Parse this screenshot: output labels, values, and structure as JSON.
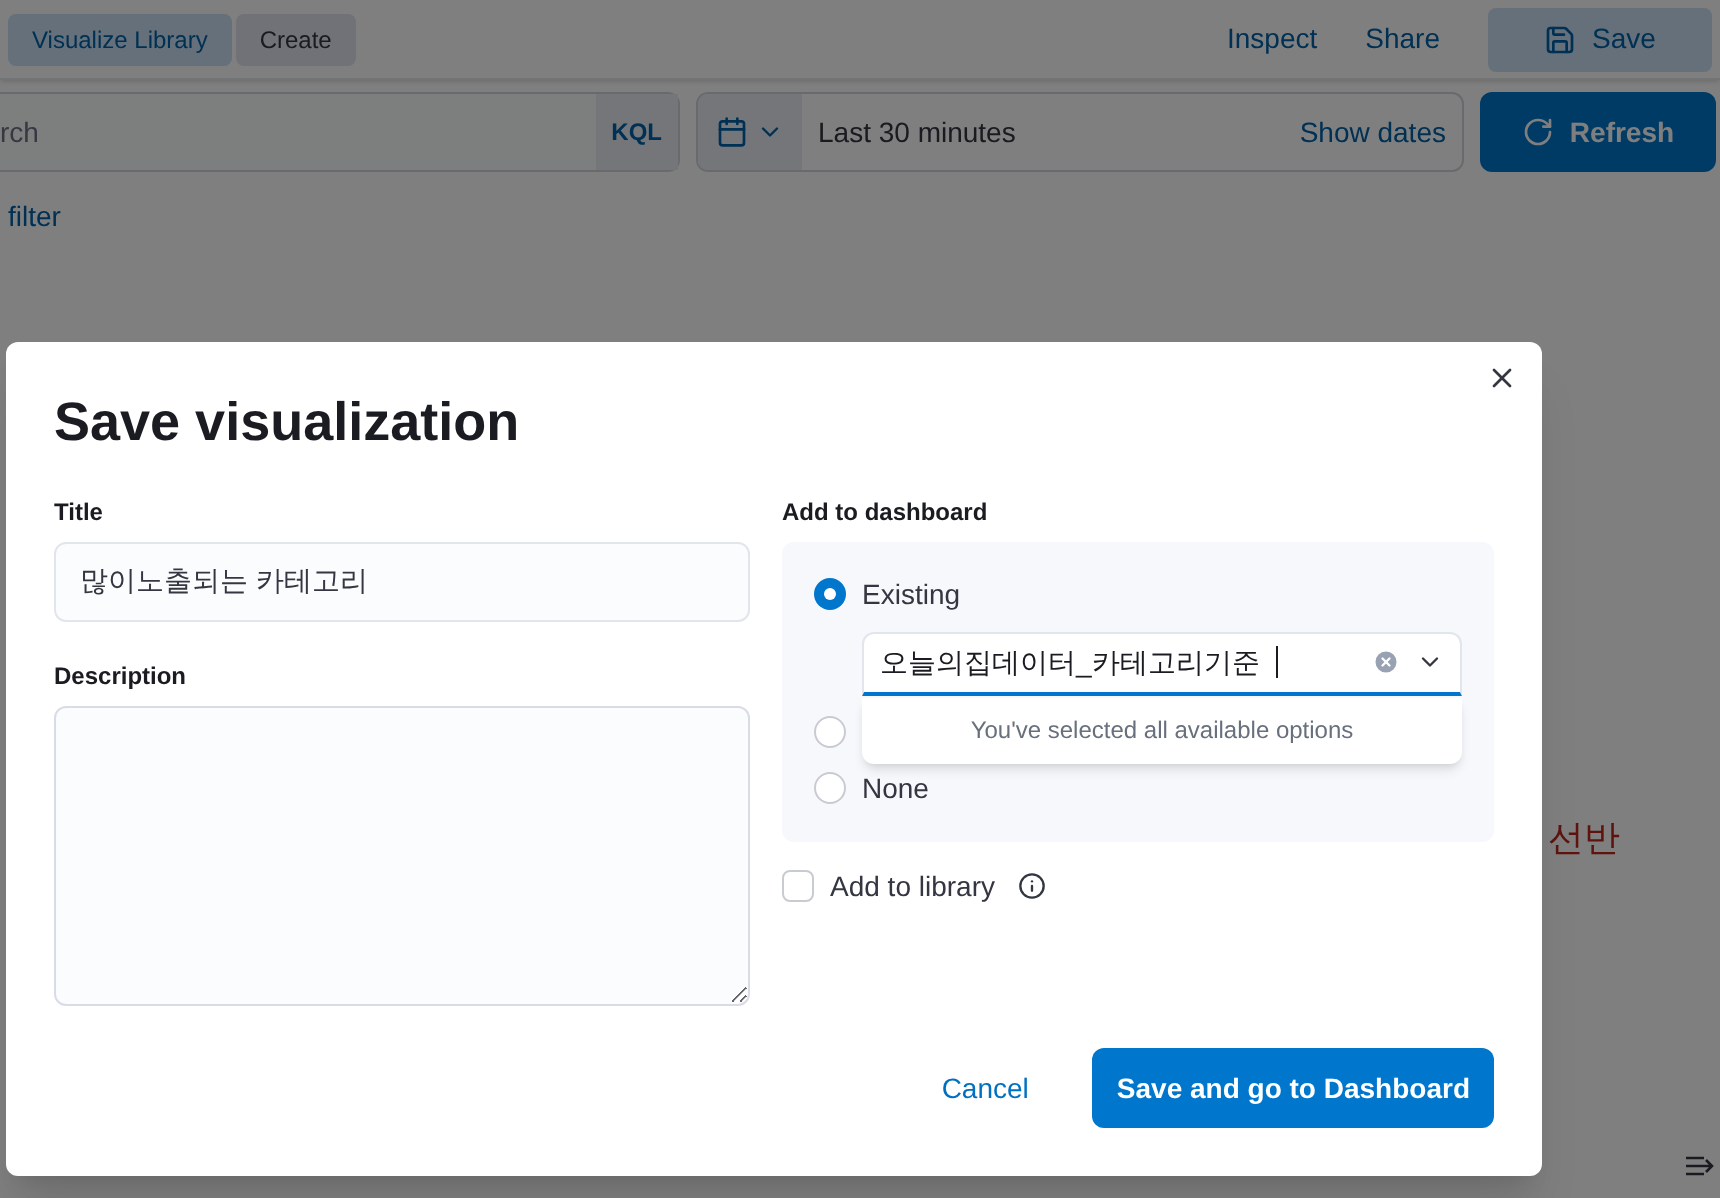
{
  "header": {
    "breadcrumbs": [
      {
        "label": "Visualize Library",
        "selected": false
      },
      {
        "label": "Create",
        "selected": true
      }
    ],
    "links": [
      "Inspect",
      "Share"
    ],
    "save_button": "Save"
  },
  "query_bar": {
    "search_value": "rch",
    "language": "KQL",
    "time_range": "Last 30 minutes",
    "show_dates": "Show dates",
    "refresh": "Refresh"
  },
  "filter_link": "filter",
  "background_text": "선반",
  "dialog": {
    "title": "Save visualization",
    "title_field": {
      "label": "Title",
      "value": "많이노출되는 카테고리"
    },
    "description_field": {
      "label": "Description"
    },
    "dashboard": {
      "label": "Add to dashboard",
      "options": [
        {
          "label": "Existing",
          "selected": true
        },
        {
          "selected": false
        },
        {
          "label": "None",
          "selected": false
        }
      ],
      "combo_value": "오늘의집데이터_카테고리기준",
      "combo_message": "You've selected all available options"
    },
    "library": {
      "label": "Add to library",
      "checked": false
    },
    "cancel": "Cancel",
    "confirm": "Save and go to Dashboard"
  }
}
